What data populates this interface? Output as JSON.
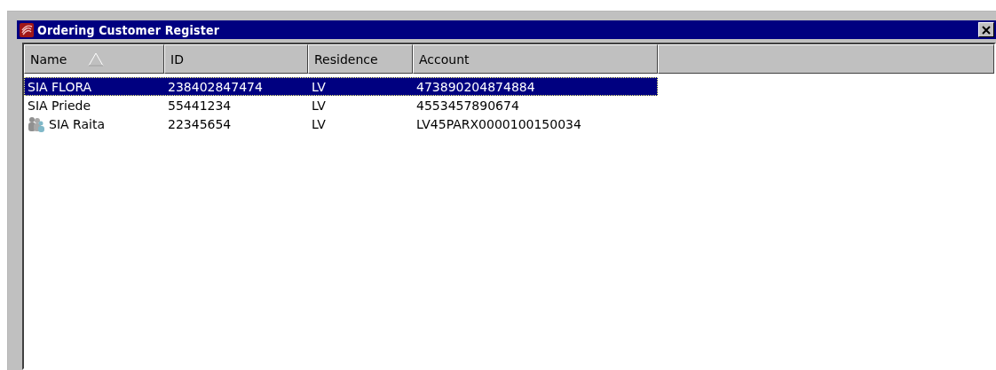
{
  "window": {
    "title": "Ordering Customer Register"
  },
  "table": {
    "columns": [
      {
        "label": "Name",
        "sorted": true
      },
      {
        "label": "ID",
        "sorted": false
      },
      {
        "label": "Residence",
        "sorted": false
      },
      {
        "label": "Account",
        "sorted": false
      }
    ],
    "rows": [
      {
        "kind": "plain",
        "selected": true,
        "cells": [
          "SIA FLORA",
          "238402847474",
          "LV",
          "473890204874884"
        ]
      },
      {
        "kind": "plain",
        "selected": false,
        "cells": [
          "SIA Priede",
          "55441234",
          "LV",
          "4553457890674"
        ]
      },
      {
        "kind": "group",
        "selected": false,
        "cells": [
          "SIA Raita",
          "22345654",
          "LV",
          "LV45PARX0000100150034"
        ]
      }
    ]
  }
}
